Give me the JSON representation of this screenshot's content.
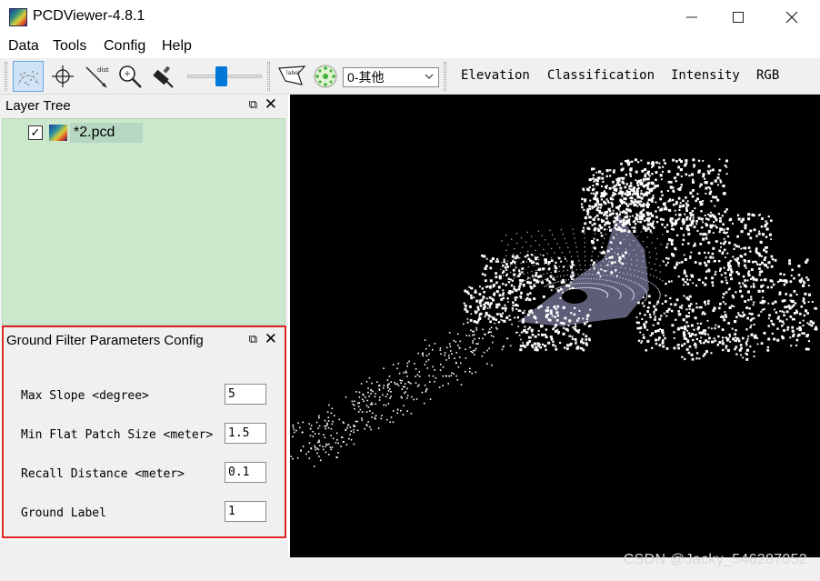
{
  "window": {
    "title": "PCDViewer-4.8.1",
    "minimize_glyph": "─",
    "maximize_glyph": "☐",
    "close_glyph": "✕"
  },
  "menu": {
    "data": "Data",
    "tools": "Tools",
    "config": "Config",
    "help": "Help"
  },
  "toolbar": {
    "tools": [
      {
        "icon": "point-cloud-select-icon",
        "active": true
      },
      {
        "icon": "crosshair-pick-icon"
      },
      {
        "icon": "distance-measure-icon",
        "text": "dist"
      },
      {
        "icon": "zoom-icon"
      },
      {
        "icon": "brush-icon"
      }
    ],
    "slider_position": 0.45,
    "label_tool_text": "label",
    "class_select_value": "0-其他",
    "color_modes": [
      "Elevation",
      "Classification",
      "Intensity",
      "RGB"
    ]
  },
  "layer_tree": {
    "title": "Layer Tree",
    "float_glyph": "⧉",
    "close_glyph": "✕",
    "items": [
      {
        "name": "*2.pcd",
        "checked": true,
        "check_glyph": "✓"
      }
    ]
  },
  "ground_filter": {
    "title": "Ground Filter Parameters Config",
    "float_glyph": "⧉",
    "close_glyph": "✕",
    "params": [
      {
        "label": "Max Slope <degree>",
        "value": "5"
      },
      {
        "label": "Min Flat Patch Size <meter>",
        "value": "1.5"
      },
      {
        "label": "Recall Distance <meter>",
        "value": "0.1"
      },
      {
        "label": "Ground Label",
        "value": "1"
      }
    ]
  },
  "viewport": {
    "background_color": "#000000",
    "ground_point_color": "#7c7ca0",
    "point_color": "#ffffff"
  },
  "watermark": "CSDN @Jacky_546287052"
}
